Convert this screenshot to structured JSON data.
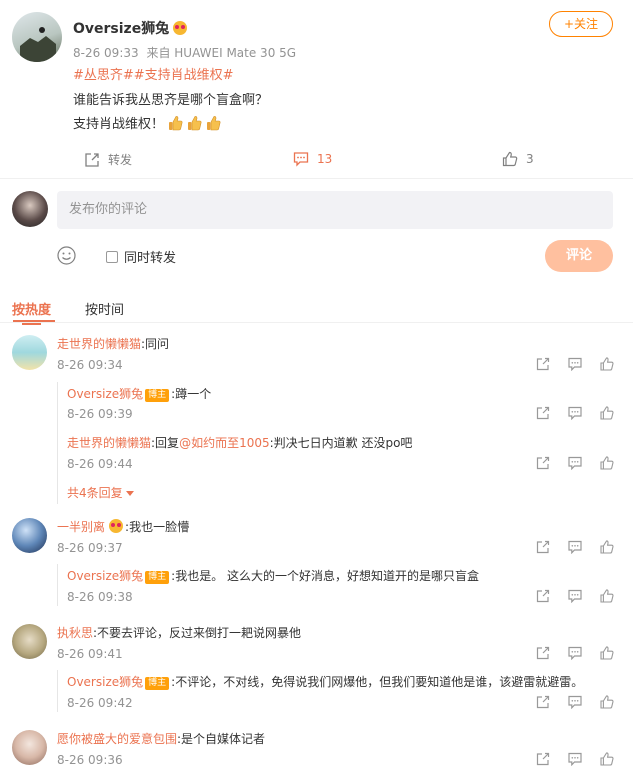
{
  "post": {
    "username": "Oversize狮兔",
    "follow_label": "+关注",
    "date": "8-26 09:33",
    "source": "来自 HUAWEI Mate 30 5G",
    "hashtags": "#丛思齐##支持肖战维权#",
    "line1": "谁能告诉我丛思齐是哪个盲盒啊？",
    "line2": "支持肖战维权！",
    "repost_label": "转发",
    "comment_count": "13",
    "like_count": "3"
  },
  "composer": {
    "placeholder": "发布你的评论",
    "repost_option": "同时转发",
    "submit_label": "评论"
  },
  "tabs": {
    "hot": "按热度",
    "time": "按时间"
  },
  "comments": [
    {
      "name": "走世界的懒懒猫",
      "text": ":同问",
      "date": "8-26 09:34",
      "replies": [
        {
          "name": "Oversize狮兔",
          "badge": "博主",
          "text": ":蹲一个",
          "date": "8-26 09:39"
        },
        {
          "name": "走世界的懒懒猫",
          "prefix": ":回复",
          "mention": "@如约而至1005",
          "text": ":判决七日内道歉 还没po吧",
          "date": "8-26 09:44"
        }
      ],
      "more_label": "共4条回复"
    },
    {
      "name": "一半别离",
      "text": "我也一脸懵",
      "date": "8-26 09:37",
      "replies": [
        {
          "name": "Oversize狮兔",
          "badge": "博主",
          "text": ":我也是。 这么大的一个好消息，好想知道开的是哪只盲盒",
          "date": "8-26 09:38"
        }
      ]
    },
    {
      "name": "执秋思",
      "text": ":不要去评论，反过来倒打一耙说网暴他",
      "date": "8-26 09:41",
      "replies": [
        {
          "name": "Oversize狮兔",
          "badge": "博主",
          "text": ":不评论，不对线，免得说我们网爆他，但我们要知道他是谁，该避雷就避雷。",
          "date": "8-26 09:42"
        }
      ]
    },
    {
      "name": "愿你被盛大的爱意包围",
      "text": ":是个自媒体记者",
      "date": "8-26 09:36"
    }
  ],
  "colors": {
    "accent": "#eb7350",
    "follow": "#ff8200",
    "submit": "#ffc09f",
    "badge": "#ffa00a"
  }
}
